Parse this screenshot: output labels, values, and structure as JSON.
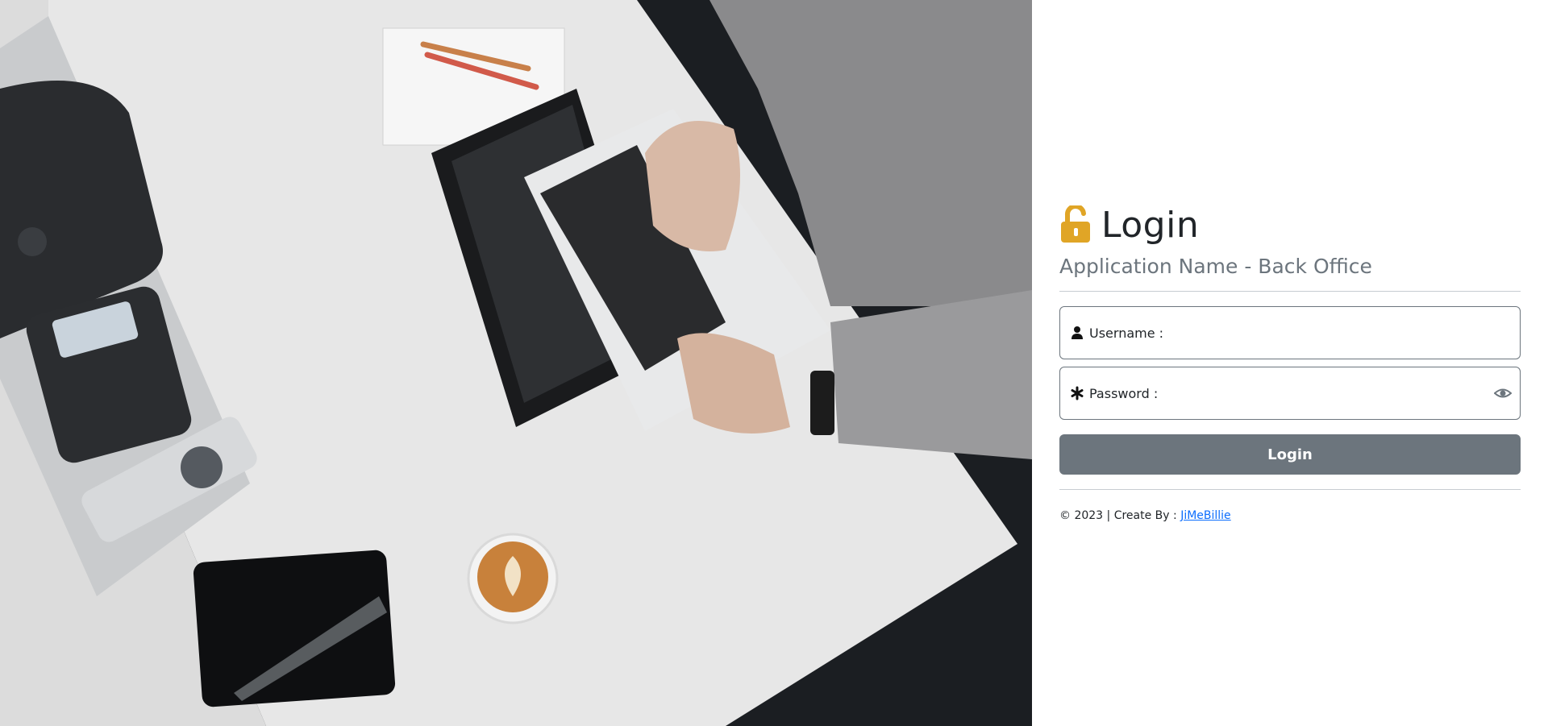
{
  "login": {
    "title": "Login",
    "subtitle": "Application Name - Back Office",
    "username_label": "Username :",
    "password_label": "Password :",
    "button_label": "Login",
    "icons": {
      "lock": "unlock-icon",
      "user": "user-icon",
      "password": "asterisk-icon",
      "toggle": "eye-icon"
    },
    "lock_color": "#e0a526",
    "button_color": "#6c757d"
  },
  "footer": {
    "text": "© 2023 | Create By :",
    "author_link": "JiMeBillie"
  },
  "background": {
    "description_icon": "office-desk-photo"
  }
}
